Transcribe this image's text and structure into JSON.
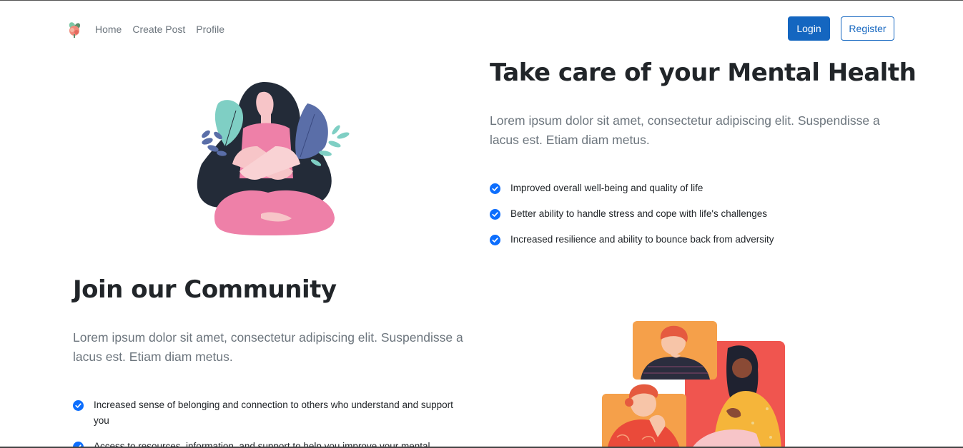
{
  "nav": {
    "links": [
      "Home",
      "Create Post",
      "Profile"
    ],
    "login": "Login",
    "register": "Register"
  },
  "hero": {
    "title": "Take care of your Mental Health",
    "lead": "Lorem ipsum dolor sit amet, consectetur adipiscing elit. Suspendisse a lacus est. Etiam diam metus.",
    "points": [
      "Improved overall well-being and quality of life",
      "Better ability to handle stress and cope with life's challenges",
      "Increased resilience and ability to bounce back from adversity"
    ]
  },
  "community": {
    "title": "Join our Community",
    "lead": "Lorem ipsum dolor sit amet, consectetur adipiscing elit. Suspendisse a lacus est. Etiam diam metus.",
    "points": [
      "Increased sense of belonging and connection to others who understand and support you",
      "Access to resources, information, and support to help you improve your mental"
    ]
  },
  "colors": {
    "primary": "#1466c0",
    "check": "#0d6efd",
    "muted": "#6c757d",
    "heading": "#212529"
  },
  "icons": {
    "brand": "flower-logo-icon",
    "check": "check-circle-icon"
  }
}
